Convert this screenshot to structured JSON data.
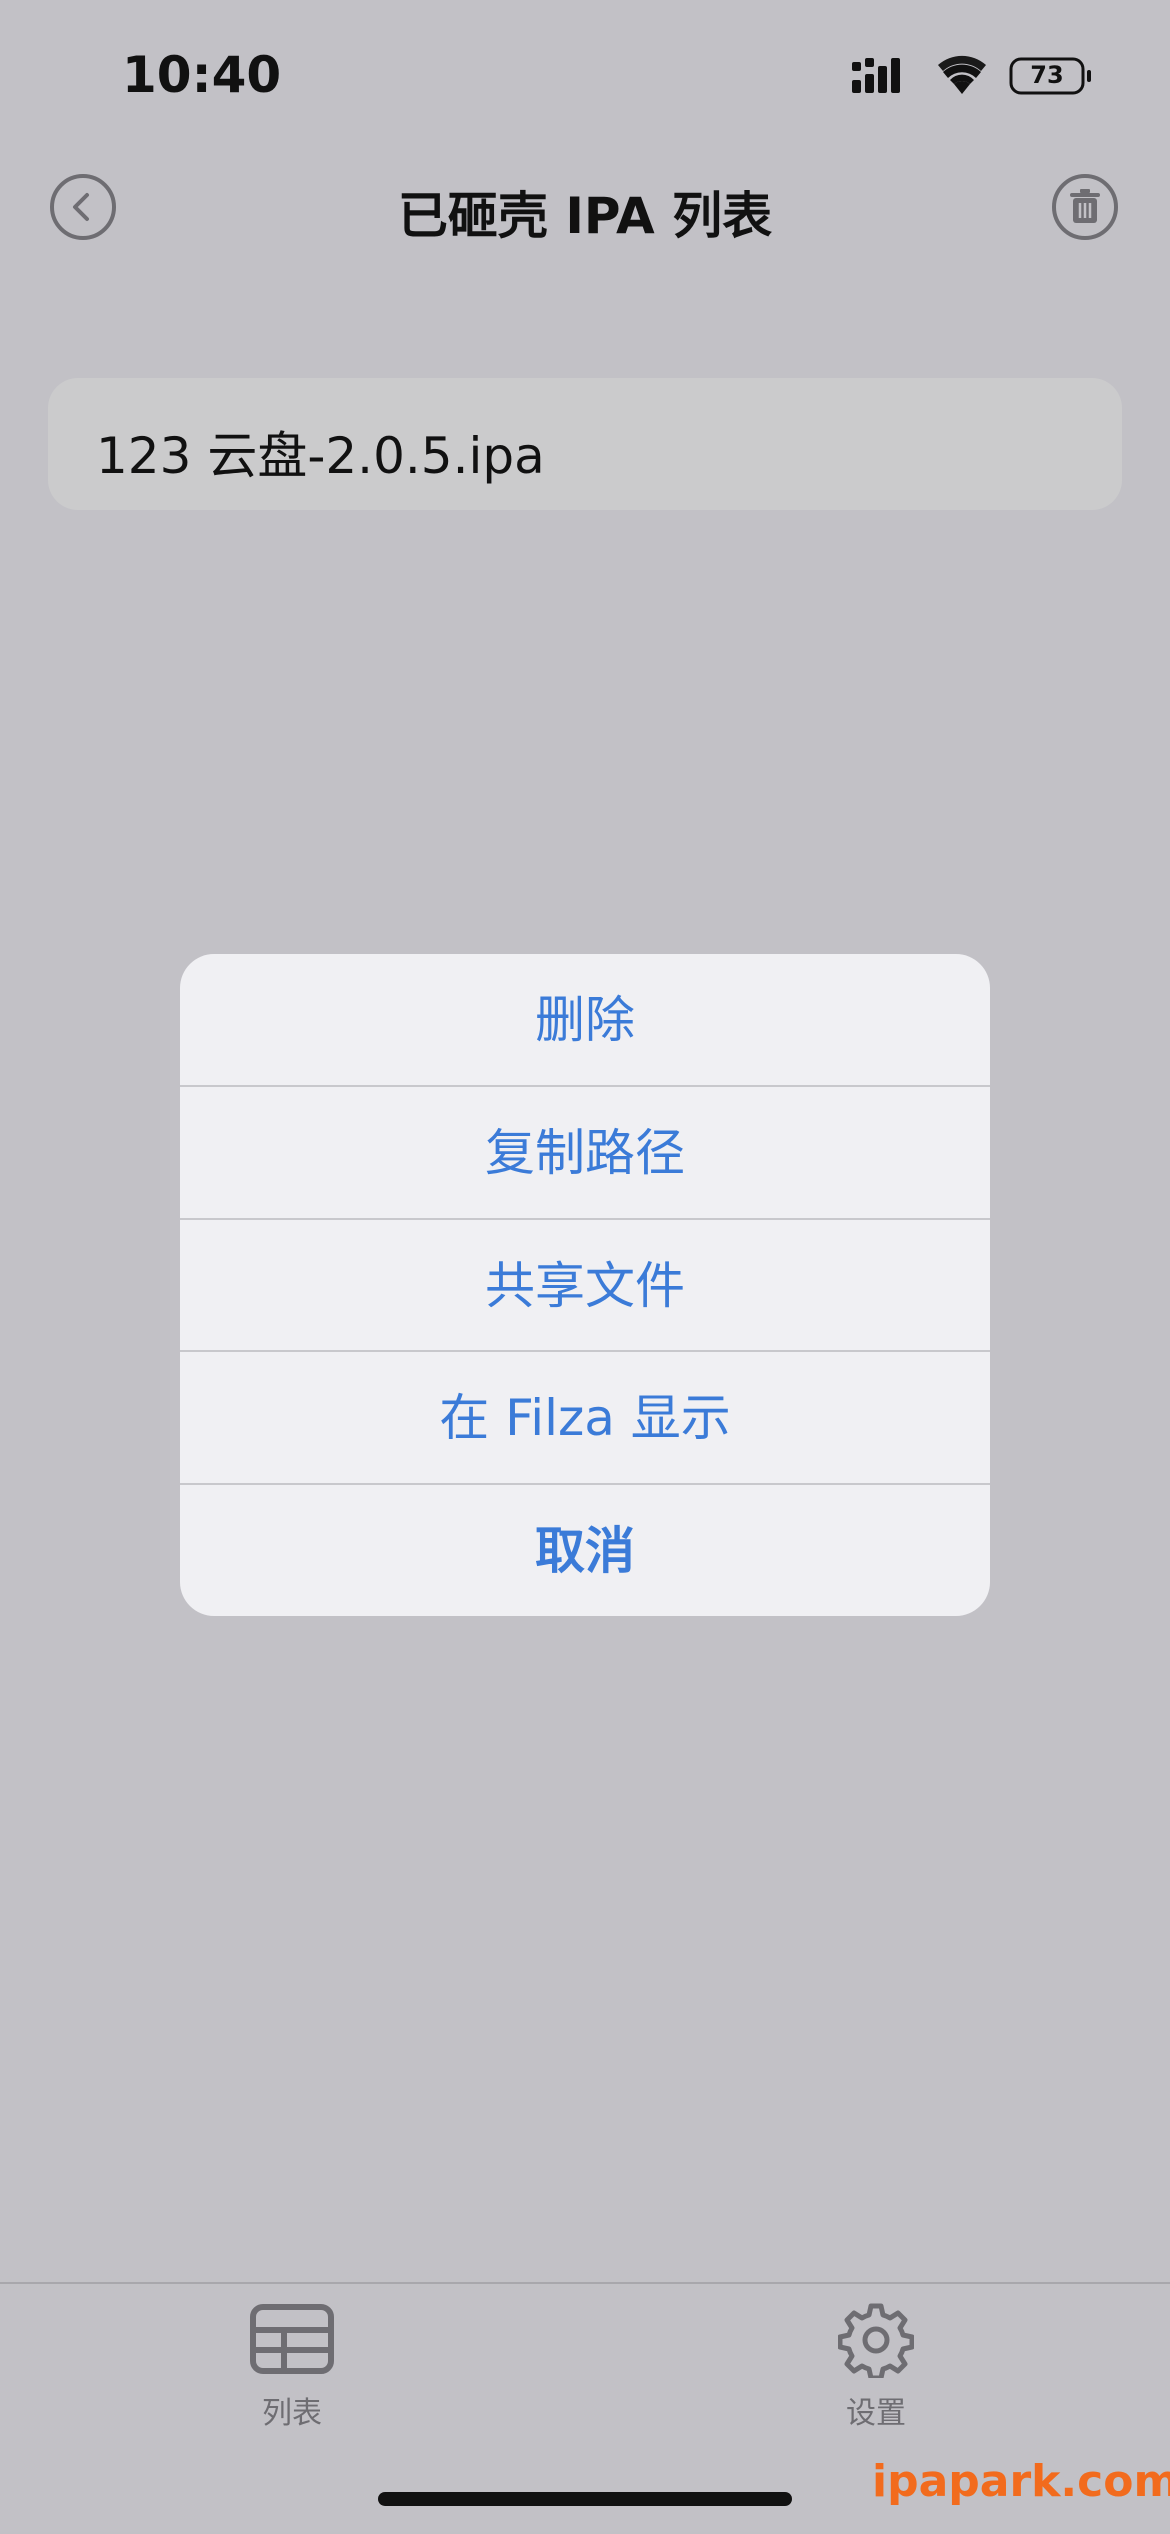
{
  "status_bar": {
    "time": "10:40",
    "battery": "73"
  },
  "nav": {
    "title": "已砸壳 IPA 列表"
  },
  "list": {
    "items": [
      {
        "label": "123 云盘-2.0.5.ipa"
      }
    ]
  },
  "action_sheet": {
    "items": [
      {
        "label": "删除"
      },
      {
        "label": "复制路径"
      },
      {
        "label": "共享文件"
      },
      {
        "label": "在 Filza 显示"
      },
      {
        "label": "取消"
      }
    ],
    "accent_color": "#3b7bd8"
  },
  "tab_bar": {
    "tabs": [
      {
        "label": "列表",
        "icon": "table-icon"
      },
      {
        "label": "设置",
        "icon": "gear-icon"
      }
    ]
  },
  "watermark": "ipapark.com"
}
